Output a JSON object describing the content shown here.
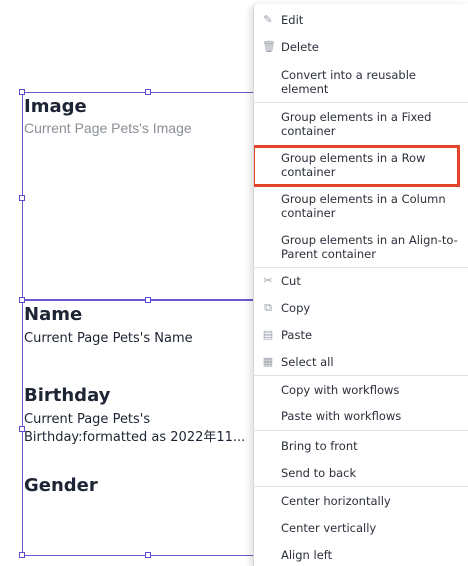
{
  "canvas": {
    "image_title": "Image",
    "image_value": "Current Page Pets's Image",
    "name_title": "Name",
    "name_value": "Current Page Pets's Name",
    "birthday_title": "Birthday",
    "birthday_value_line1": "Current Page Pets's",
    "birthday_value_line2": "Birthday:formatted as 2022年11...",
    "gender_title": "Gender"
  },
  "menu": {
    "items": [
      {
        "label": "Edit",
        "icon": "pencil-icon"
      },
      {
        "label": "Delete",
        "icon": "trash-icon"
      },
      {
        "label_line1": "Convert into a reusable",
        "label_line2": "element"
      },
      {
        "label_line1": "Group elements in a Fixed",
        "label_line2": "container"
      },
      {
        "label_line1": "Group elements in a Row",
        "label_line2": "container"
      },
      {
        "label_line1": "Group elements in a Column",
        "label_line2": "container"
      },
      {
        "label_line1": "Group elements in an Align-to-",
        "label_line2": "Parent container"
      },
      {
        "label": "Cut",
        "icon": "scissors-icon"
      },
      {
        "label": "Copy",
        "icon": "copy-icon"
      },
      {
        "label": "Paste",
        "icon": "paste-icon"
      },
      {
        "label": "Select all",
        "icon": "grid-icon"
      },
      {
        "label": "Copy with workflows"
      },
      {
        "label": "Paste with workflows"
      },
      {
        "label": "Bring to front"
      },
      {
        "label": "Send to back"
      },
      {
        "label": "Center horizontally"
      },
      {
        "label": "Center vertically"
      },
      {
        "label": "Align left"
      }
    ]
  },
  "side_tab": "?",
  "colors": {
    "highlight": "#e0452a",
    "selection": "#6a5acd"
  }
}
